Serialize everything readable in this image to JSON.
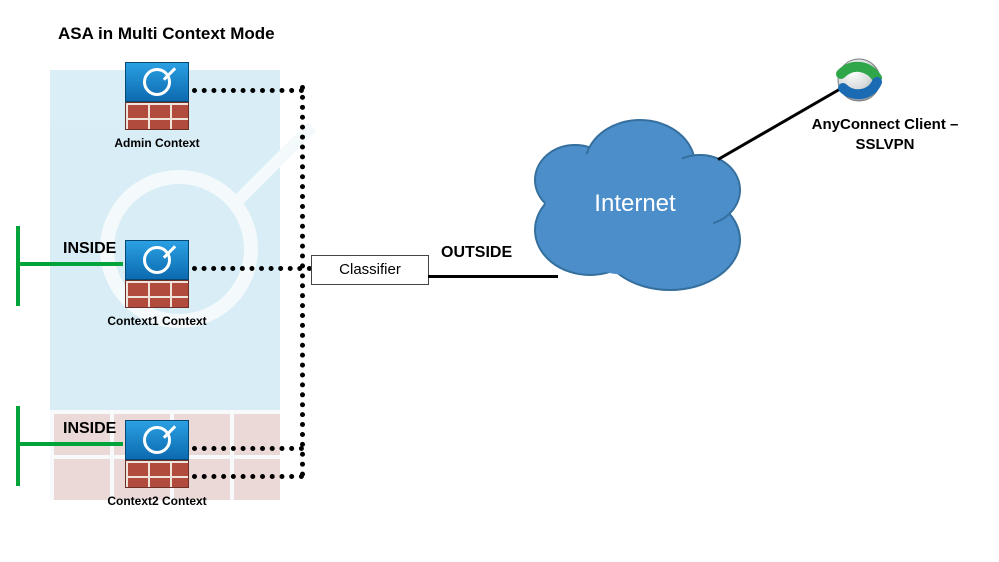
{
  "title": "ASA in Multi Context Mode",
  "contexts": [
    {
      "label": "Admin Context"
    },
    {
      "label": "Context1 Context"
    },
    {
      "label": "Context2 Context"
    }
  ],
  "classifier_label": "Classifier",
  "zones": {
    "inside": "INSIDE",
    "outside": "OUTSIDE"
  },
  "cloud_label": "Internet",
  "client": {
    "line1": "AnyConnect Client –",
    "line2": "SSLVPN"
  },
  "colors": {
    "inside_rail": "#00a43b",
    "cloud_fill": "#4b8ec9",
    "firewall_cube": "#1b86cf",
    "firewall_brick": "#b14b3e"
  }
}
